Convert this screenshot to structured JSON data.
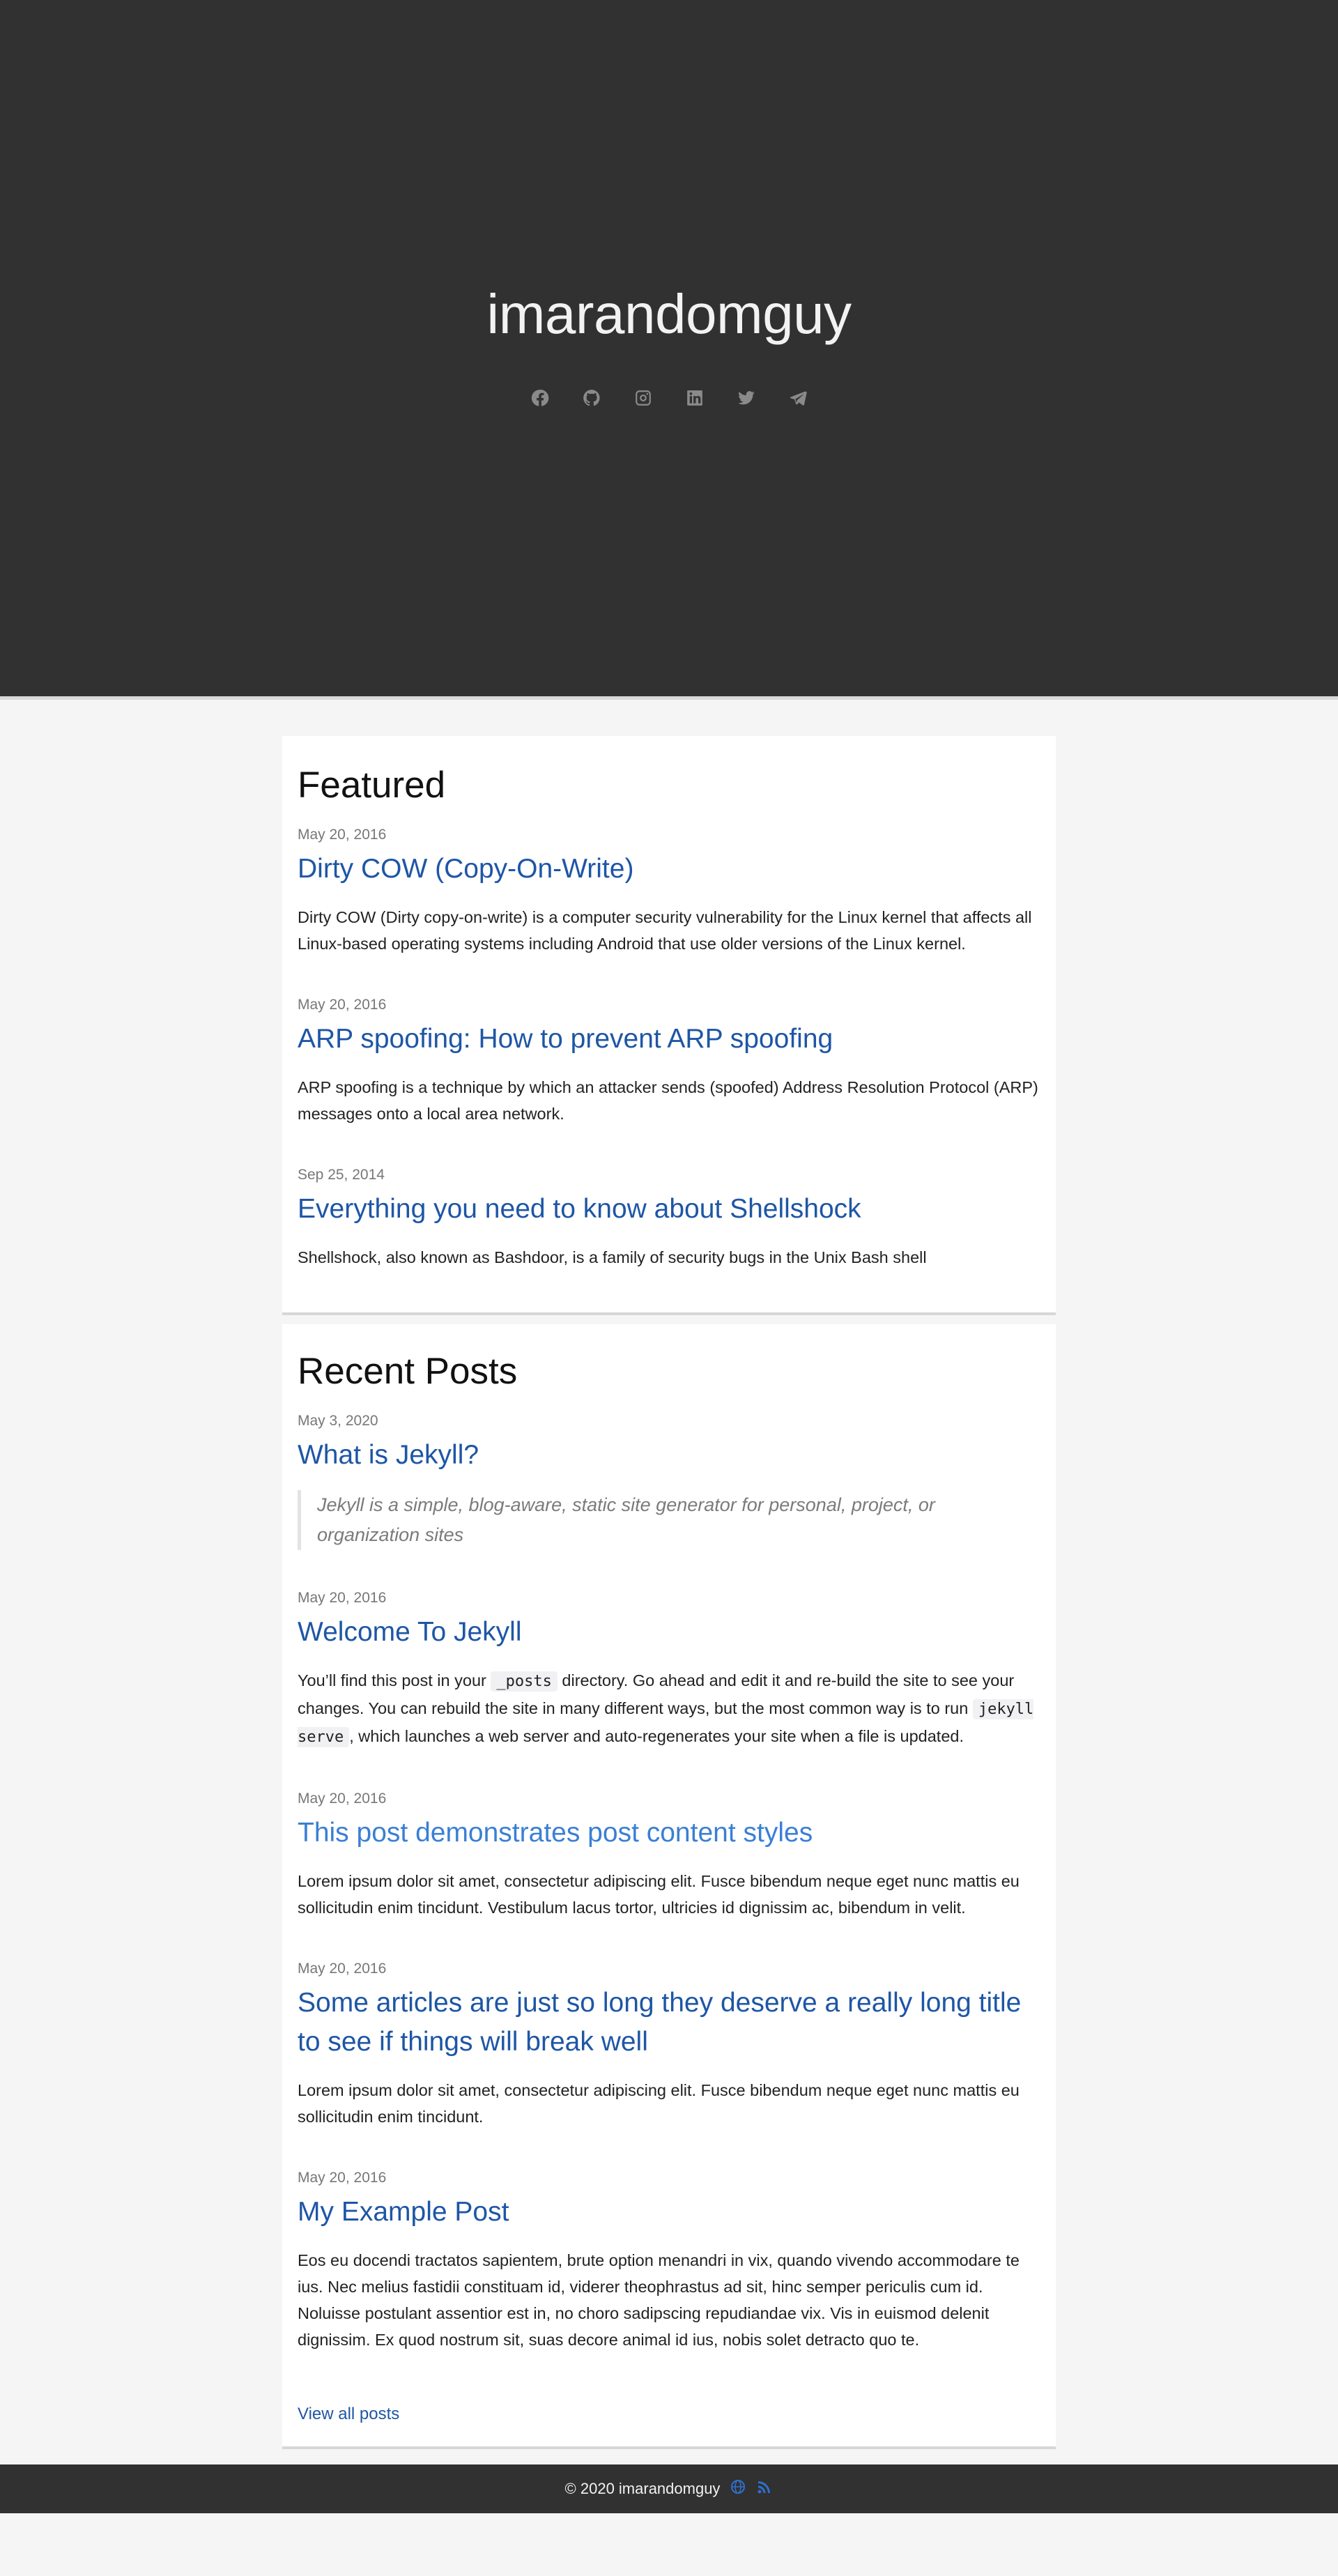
{
  "site": {
    "title": "imarandomguy"
  },
  "social": [
    {
      "name": "facebook-icon"
    },
    {
      "name": "github-icon"
    },
    {
      "name": "instagram-icon"
    },
    {
      "name": "linkedin-icon"
    },
    {
      "name": "twitter-icon"
    },
    {
      "name": "telegram-icon"
    }
  ],
  "featured": {
    "title": "Featured",
    "posts": [
      {
        "date": "May 20, 2016",
        "title": "Dirty COW (Copy-On-Write)",
        "excerpt": "Dirty COW (Dirty copy-on-write) is a computer security vulnerability for the Linux kernel that affects all Linux-based operating systems including Android that use older versions of the Linux kernel."
      },
      {
        "date": "May 20, 2016",
        "title": "ARP spoofing: How to prevent ARP spoofing",
        "excerpt": "ARP spoofing is a technique by which an attacker sends (spoofed) Address Resolution Protocol (ARP) messages onto a local area network."
      },
      {
        "date": "Sep 25, 2014",
        "title": "Everything you need to know about Shellshock",
        "excerpt": "Shellshock, also known as Bashdoor, is a family of security bugs in the Unix Bash shell"
      }
    ]
  },
  "recent": {
    "title": "Recent Posts",
    "posts": [
      {
        "date": "May 3, 2020",
        "title": "What is Jekyll?",
        "quote": "Jekyll is a simple, blog-aware, static site generator for personal, project, or organization sites"
      },
      {
        "date": "May 20, 2016",
        "title": "Welcome To Jekyll",
        "excerpt_part1": "You’ll find this post in your ",
        "code1": "_posts",
        "excerpt_part2": " directory. Go ahead and edit it and re-build the site to see your changes. You can rebuild the site in many different ways, but the most common way is to run ",
        "code2": "jekyll serve",
        "excerpt_part3": ", which launches a web server and auto-regenerates your site when a file is updated."
      },
      {
        "date": "May 20, 2016",
        "title": "This post demonstrates post content styles",
        "excerpt": "Lorem ipsum dolor sit amet, consectetur adipiscing elit. Fusce bibendum neque eget nunc mattis eu sollicitudin enim tincidunt. Vestibulum lacus tortor, ultricies id dignissim ac, bibendum in velit."
      },
      {
        "date": "May 20, 2016",
        "title": "Some articles are just so long they deserve a really long title to see if things will break well",
        "excerpt": "Lorem ipsum dolor sit amet, consectetur adipiscing elit. Fusce bibendum neque eget nunc mattis eu sollicitudin enim tincidunt."
      },
      {
        "date": "May 20, 2016",
        "title": "My Example Post",
        "excerpt": "Eos eu docendi tractatos sapientem, brute option menandri in vix, quando vivendo accommodare te ius. Nec melius fastidii constituam id, viderer theophrastus ad sit, hinc semper periculis cum id. Noluisse postulant assentior est in, no choro sadipscing repudiandae vix. Vis in euismod delenit dignissim. Ex quod nostrum sit, suas decore animal id ius, nobis solet detracto quo te."
      }
    ],
    "view_all": "View all posts"
  },
  "footer": {
    "copyright": "© 2020 imarandomguy",
    "icons": [
      "globe-icon",
      "rss-icon"
    ],
    "accent": "#2f6fd0"
  }
}
